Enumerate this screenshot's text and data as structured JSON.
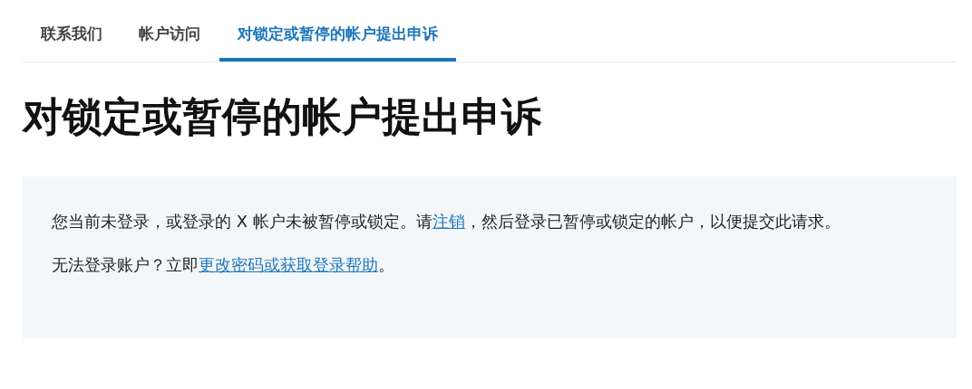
{
  "tabs": [
    {
      "label": "联系我们",
      "selected": false
    },
    {
      "label": "帐户访问",
      "selected": false
    },
    {
      "label": "对锁定或暂停的帐户提出申诉",
      "selected": true
    }
  ],
  "heading": "对锁定或暂停的帐户提出申诉",
  "notice": {
    "paragraphs": [
      {
        "parts": [
          {
            "kind": "text",
            "text": "您当前未登录，或登录的 X 帐户未被暂停或锁定。请"
          },
          {
            "kind": "link",
            "text": "注销"
          },
          {
            "kind": "text",
            "text": "，然后登录已暂停或锁定的帐户，以便提交此请求。"
          }
        ]
      },
      {
        "parts": [
          {
            "kind": "text",
            "text": "无法登录账户？立即"
          },
          {
            "kind": "link",
            "text": "更改密码或获取登录帮助"
          },
          {
            "kind": "text",
            "text": "。"
          }
        ]
      }
    ]
  }
}
